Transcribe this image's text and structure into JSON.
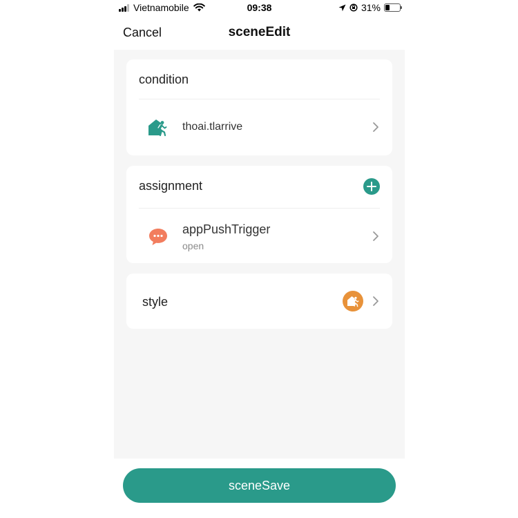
{
  "status_bar": {
    "carrier": "Vietnamobile",
    "time": "09:38",
    "battery_percent": "31%",
    "battery_level": 0.31
  },
  "nav": {
    "cancel_label": "Cancel",
    "title": "sceneEdit"
  },
  "condition": {
    "header": "condition",
    "items": [
      {
        "label": "thoai.tlarrive",
        "icon": "home-walk-icon"
      }
    ]
  },
  "assignment": {
    "header": "assignment",
    "items": [
      {
        "label": "appPushTrigger",
        "sublabel": "open",
        "icon": "chat-bubble-icon"
      }
    ]
  },
  "style": {
    "label": "style",
    "icon": "home-walk-icon"
  },
  "save_label": "sceneSave",
  "colors": {
    "accent": "#2a9a8a",
    "chat": "#f27d5e",
    "style": "#e8923a",
    "background": "#f6f6f6"
  }
}
